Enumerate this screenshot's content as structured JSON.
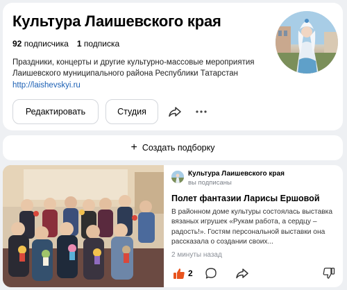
{
  "channel": {
    "title": "Культура Лаишевского края",
    "subscribers_count": "92",
    "subscribers_label": "подписчика",
    "subscriptions_count": "1",
    "subscriptions_label": "подписка",
    "description": "Праздники, концерты и другие культурно-массовые мероприятия Лаишевского муниципального района Республики Татарстан",
    "link": "http://laishevskyi.ru"
  },
  "buttons": {
    "edit_label": "Редактировать",
    "studio_label": "Студия",
    "share_icon": "share-icon",
    "more_icon": "more-icon"
  },
  "create_collection": {
    "label": "Создать подборку"
  },
  "post": {
    "author": "Культура Лаишевского края",
    "subscription_status": "вы подписаны",
    "title": "Полет фантазии Ларисы Ершовой",
    "text": "В районном доме культуры состоялась выставка вязаных игрушек «Рукам работа, а сердцу – радость!». Гостям персональной выставки она рассказала о создании своих...",
    "time": "2 минуты назад",
    "likes": "2",
    "like_color": "#e8541e"
  }
}
